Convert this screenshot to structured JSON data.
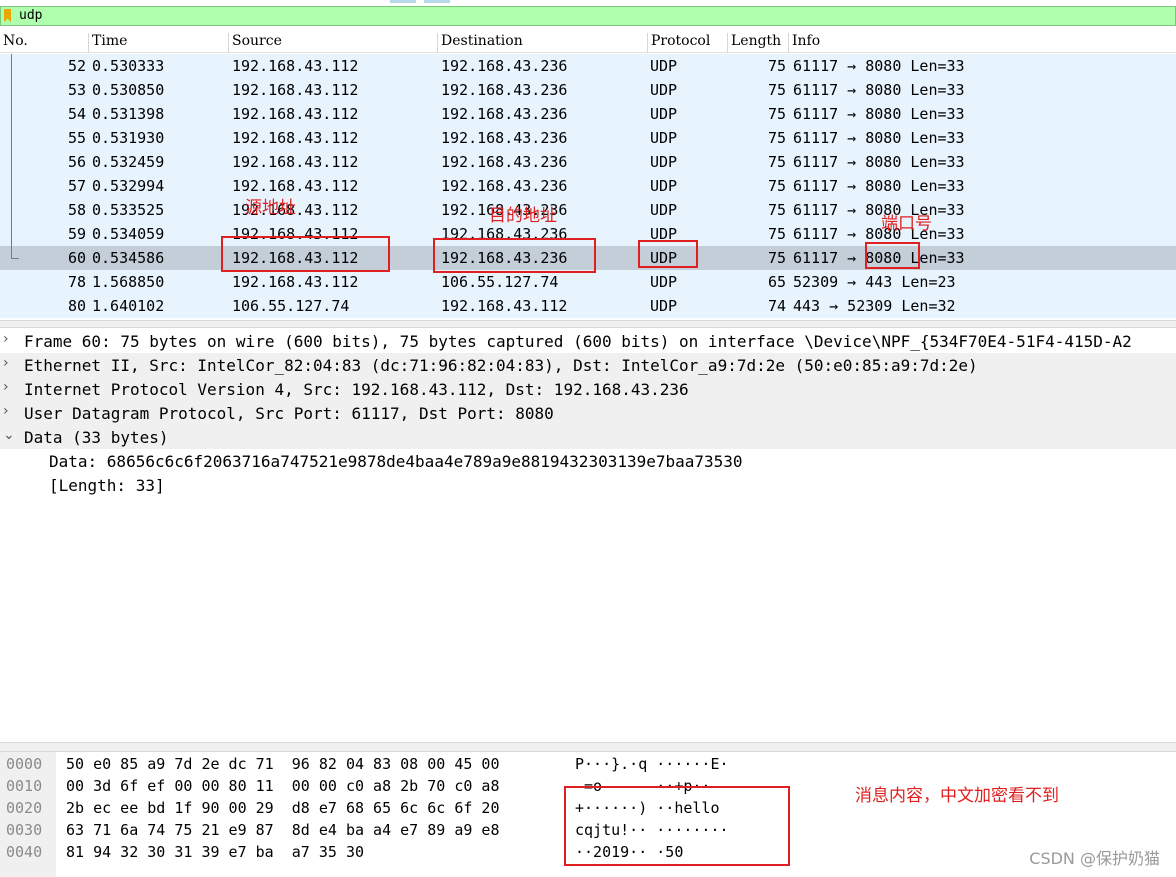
{
  "filter": {
    "value": "udp"
  },
  "columns": [
    "No.",
    "Time",
    "Source",
    "Destination",
    "Protocol",
    "Length",
    "Info"
  ],
  "packets": [
    {
      "no": "52",
      "time": "0.530333",
      "src": "192.168.43.112",
      "dst": "192.168.43.236",
      "proto": "UDP",
      "len": "75",
      "info": "61117 → 8080 Len=33"
    },
    {
      "no": "53",
      "time": "0.530850",
      "src": "192.168.43.112",
      "dst": "192.168.43.236",
      "proto": "UDP",
      "len": "75",
      "info": "61117 → 8080 Len=33"
    },
    {
      "no": "54",
      "time": "0.531398",
      "src": "192.168.43.112",
      "dst": "192.168.43.236",
      "proto": "UDP",
      "len": "75",
      "info": "61117 → 8080 Len=33"
    },
    {
      "no": "55",
      "time": "0.531930",
      "src": "192.168.43.112",
      "dst": "192.168.43.236",
      "proto": "UDP",
      "len": "75",
      "info": "61117 → 8080 Len=33"
    },
    {
      "no": "56",
      "time": "0.532459",
      "src": "192.168.43.112",
      "dst": "192.168.43.236",
      "proto": "UDP",
      "len": "75",
      "info": "61117 → 8080 Len=33"
    },
    {
      "no": "57",
      "time": "0.532994",
      "src": "192.168.43.112",
      "dst": "192.168.43.236",
      "proto": "UDP",
      "len": "75",
      "info": "61117 → 8080 Len=33"
    },
    {
      "no": "58",
      "time": "0.533525",
      "src": "192.168.43.112",
      "dst": "192.168.43.236",
      "proto": "UDP",
      "len": "75",
      "info": "61117 → 8080 Len=33"
    },
    {
      "no": "59",
      "time": "0.534059",
      "src": "192.168.43.112",
      "dst": "192.168.43.236",
      "proto": "UDP",
      "len": "75",
      "info": "61117 → 8080 Len=33"
    },
    {
      "no": "60",
      "time": "0.534586",
      "src": "192.168.43.112",
      "dst": "192.168.43.236",
      "proto": "UDP",
      "len": "75",
      "info": "61117 → 8080 Len=33"
    },
    {
      "no": "78",
      "time": "1.568850",
      "src": "192.168.43.112",
      "dst": "106.55.127.74",
      "proto": "UDP",
      "len": "65",
      "info": "52309 → 443 Len=23"
    },
    {
      "no": "80",
      "time": "1.640102",
      "src": "106.55.127.74",
      "dst": "192.168.43.112",
      "proto": "UDP",
      "len": "74",
      "info": "443 → 52309 Len=32"
    }
  ],
  "details": [
    {
      "arrow": "›",
      "text": "Frame 60: 75 bytes on wire (600 bits), 75 bytes captured (600 bits) on interface \\Device\\NPF_{534F70E4-51F4-415D-A2"
    },
    {
      "arrow": "›",
      "text": "Ethernet II, Src: IntelCor_82:04:83 (dc:71:96:82:04:83), Dst: IntelCor_a9:7d:2e (50:e0:85:a9:7d:2e)"
    },
    {
      "arrow": "›",
      "text": "Internet Protocol Version 4, Src: 192.168.43.112, Dst: 192.168.43.236"
    },
    {
      "arrow": "›",
      "text": "User Datagram Protocol, Src Port: 61117, Dst Port: 8080"
    },
    {
      "arrow": "⌄",
      "text": "Data (33 bytes)"
    },
    {
      "arrow": "",
      "text": "Data: 68656c6c6f2063716a747521e9878de4baa4e789a9e8819432303139e7baa73530"
    },
    {
      "arrow": "",
      "text": "[Length: 33]"
    }
  ],
  "hex": [
    {
      "off": "0000",
      "hex": "50 e0 85 a9 7d 2e dc 71  96 82 04 83 08 00 45 00",
      "ascii": "P···}.·q ······E·"
    },
    {
      "off": "0010",
      "hex": "00 3d 6f ef 00 00 80 11  00 00 c0 a8 2b 70 c0 a8",
      "ascii": " =o      ··+p··"
    },
    {
      "off": "0020",
      "hex": "2b ec ee bd 1f 90 00 29  d8 e7 68 65 6c 6c 6f 20",
      "ascii": "+······) ··hello "
    },
    {
      "off": "0030",
      "hex": "63 71 6a 74 75 21 e9 87  8d e4 ba a4 e7 89 a9 e8",
      "ascii": "cqjtu!·· ········"
    },
    {
      "off": "0040",
      "hex": "81 94 32 30 31 39 e7 ba  a7 35 30",
      "ascii": "··2019·· ·50"
    }
  ],
  "annotations": {
    "source": "源地址",
    "destination": "目的地址",
    "port": "端口号",
    "message": "消息内容，中文加密看不到"
  },
  "colors": {
    "annotation": "#e02020",
    "row_bg": "#e7f3fd",
    "row_selected": "#c3ced9",
    "filter_bg": "#afffaf"
  },
  "watermark": "CSDN @保护奶猫"
}
